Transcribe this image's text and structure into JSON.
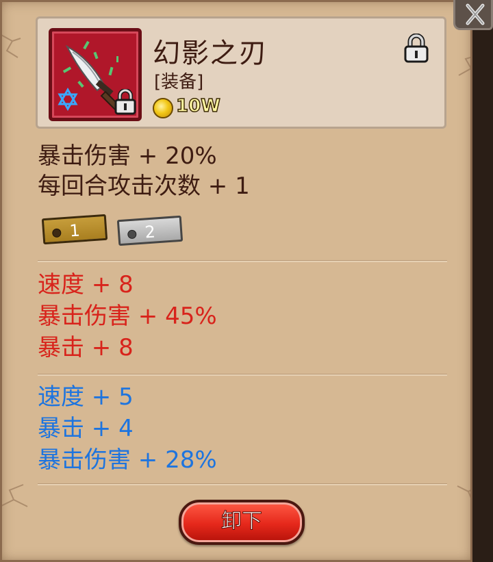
{
  "item": {
    "name": "幻影之刃",
    "type": "[装备]",
    "price": "10W",
    "icon": "phantom-blade-dagger",
    "rarity_color": "#b0172a"
  },
  "base_stats": [
    "暴击伤害 + 20%",
    "每回合攻击次数 + 1"
  ],
  "tags": [
    {
      "label": "1"
    },
    {
      "label": "2"
    }
  ],
  "red_stats": [
    "速度 + 8",
    "暴击伤害 + 45%",
    "暴击 + 8"
  ],
  "blue_stats": [
    "速度 + 5",
    "暴击 + 4",
    "暴击伤害 + 28%"
  ],
  "colors": {
    "panel": "#d6b893",
    "red_stat": "#d8231b",
    "blue_stat": "#1d74df",
    "button": "#e5281b"
  },
  "actions": {
    "unequip_label": "卸下"
  }
}
